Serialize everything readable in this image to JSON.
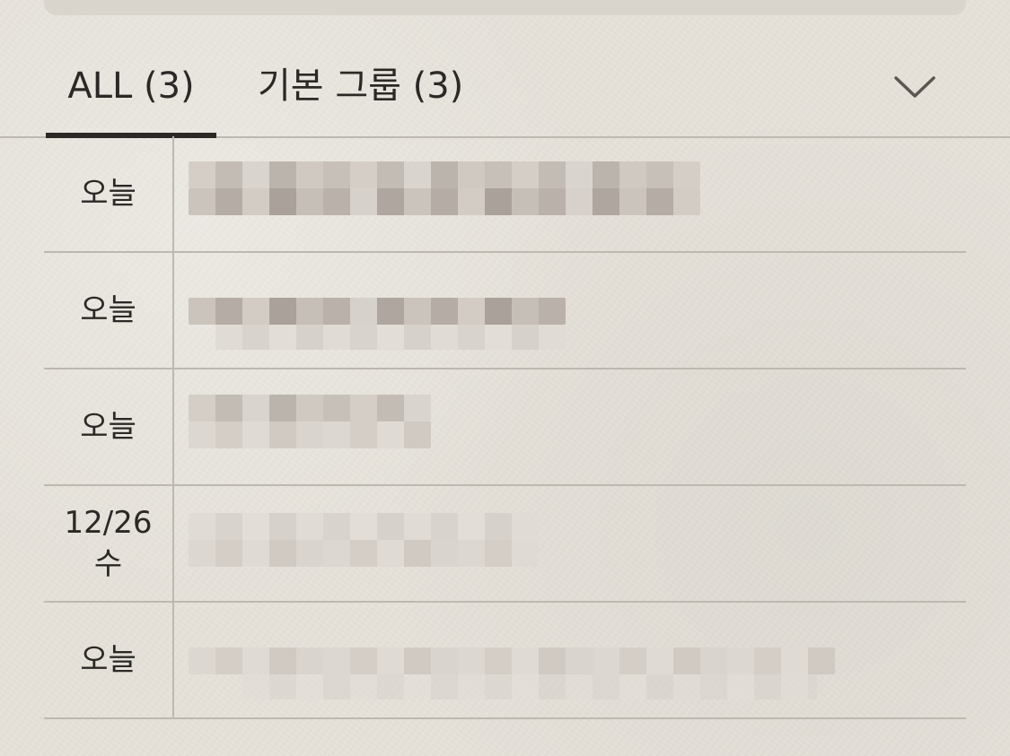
{
  "tabs": {
    "all_label": "ALL (3)",
    "basic_group_label": "기본 그룹 (3)"
  },
  "rows": [
    {
      "date": "오늘",
      "weekday": ""
    },
    {
      "date": "오늘",
      "weekday": ""
    },
    {
      "date": "오늘",
      "weekday": ""
    },
    {
      "date": "12/26",
      "weekday": "수"
    },
    {
      "date": "오늘",
      "weekday": ""
    }
  ],
  "icons": {
    "expand": "chevron-down-icon"
  },
  "colors": {
    "background": "#e6e2da",
    "text": "#2b2926",
    "divider": "#bdb8b0",
    "active_tab_indicator": "#2b2926"
  }
}
